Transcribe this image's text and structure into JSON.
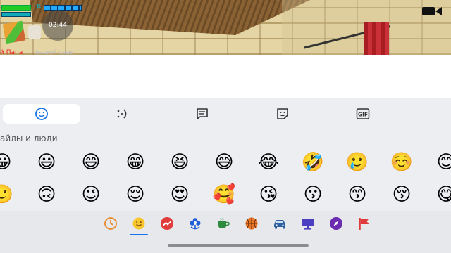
{
  "game": {
    "timer": "02:44",
    "chat_name": "й Папа",
    "chat_text": "вашей серв"
  },
  "keyboard": {
    "categories": [
      {
        "name": "smileys-tab",
        "icon": "smiley-icon",
        "active": true
      },
      {
        "name": "emoticons-tab",
        "icon": "emoticon-icon",
        "active": false
      },
      {
        "name": "text-tab",
        "icon": "chat-bubble-icon",
        "active": false
      },
      {
        "name": "stickers-tab",
        "icon": "sticker-icon",
        "active": false
      },
      {
        "name": "gif-tab",
        "icon": "gif-icon",
        "active": false
      }
    ],
    "section_label": "айлы и люди",
    "emoji_rows": [
      [
        "😀",
        "😃",
        "😄",
        "😁",
        "😆",
        "😅",
        "😂",
        "🤣",
        "🥲",
        "☺️",
        "😊"
      ],
      [
        "🙂",
        "🙃",
        "😉",
        "😌",
        "😍",
        "🥰",
        "😘",
        "😗",
        "😙",
        "😚",
        "😋"
      ]
    ],
    "footer_icons": [
      "recent-clock-icon",
      "smileys-category-icon",
      "trending-icon",
      "flower-icon",
      "coffee-cup-icon",
      "basketball-icon",
      "car-icon",
      "monitor-icon",
      "compass-icon",
      "flag-icon"
    ],
    "colors": {
      "accent": "#1a73e8",
      "tab_active_bg": "#ffffff",
      "keyboard_bg": "#eceef2"
    }
  }
}
